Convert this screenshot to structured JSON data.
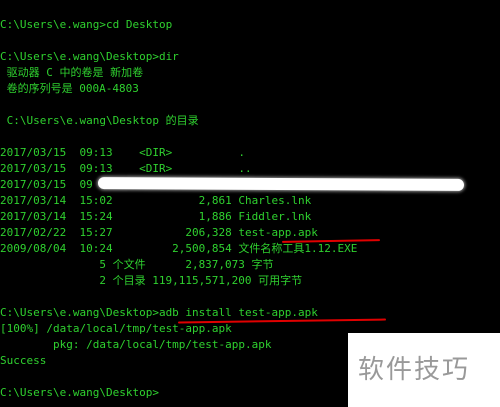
{
  "terminal": {
    "text_color": "#2fd12f",
    "lines": [
      "C:\\Users\\e.wang>cd Desktop",
      "",
      "C:\\Users\\e.wang\\Desktop>dir",
      " 驱动器 C 中的卷是 新加卷",
      " 卷的序列号是 000A-4803",
      "",
      " C:\\Users\\e.wang\\Desktop 的目录",
      "",
      "2017/03/15  09:13    <DIR>          .",
      "2017/03/15  09:13    <DIR>          ..",
      "2017/03/15  09",
      "2017/03/14  15:02             2,861 Charles.lnk",
      "2017/03/14  15:24             1,886 Fiddler.lnk",
      "2017/02/22  15:27           206,328 test-app.apk",
      "2009/08/04  10:24         2,500,854 文件名称工具1.12.EXE",
      "               5 个文件      2,837,073 字节",
      "               2 个目录 119,115,571,200 可用字节",
      "",
      "C:\\Users\\e.wang\\Desktop>adb install test-app.apk",
      "[100%] /data/local/tmp/test-app.apk",
      "        pkg: /data/local/tmp/test-app.apk",
      "Success",
      "",
      "C:\\Users\\e.wang\\Desktop>"
    ]
  },
  "watermark": {
    "text": "软件技巧",
    "color": "#999999"
  },
  "annotations": {
    "underline_color": "#e00000",
    "redaction_color": "#ffffff"
  }
}
